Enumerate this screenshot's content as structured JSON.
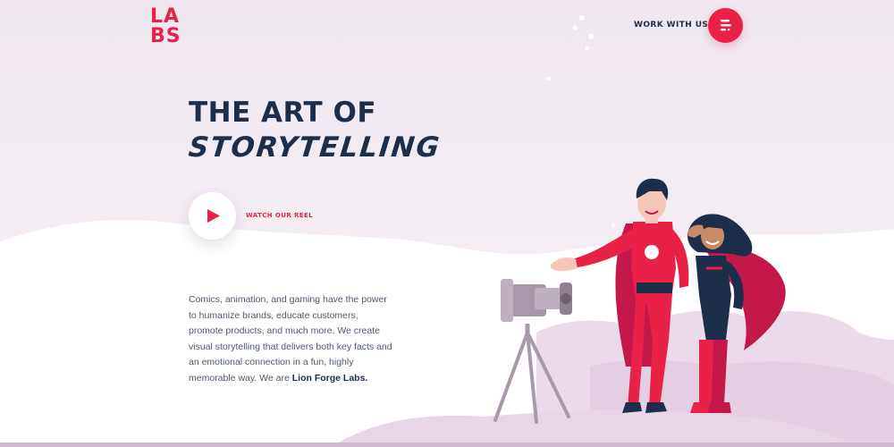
{
  "brand": {
    "logo_line_1": "LA",
    "logo_line_2": "BS",
    "accent_color": "#ea2146",
    "navy_color": "#1c2e4a"
  },
  "header": {
    "work_with_us": "WORK WITH US",
    "menu_icon": "menu-icon"
  },
  "hero": {
    "title_line_1": "THE ART OF",
    "title_line_2": "STORYTELLING",
    "reel_label": "WATCH OUR REEL",
    "play_icon": "play-icon"
  },
  "intro": {
    "text": "Comics, animation, and gaming have the power to humanize brands, educate customers, promote products, and much more. We create visual storytelling that delivers both key facts and an emotional connection in a fun, highly memorable way. We are ",
    "brand_name": "Lion Forge Labs."
  }
}
